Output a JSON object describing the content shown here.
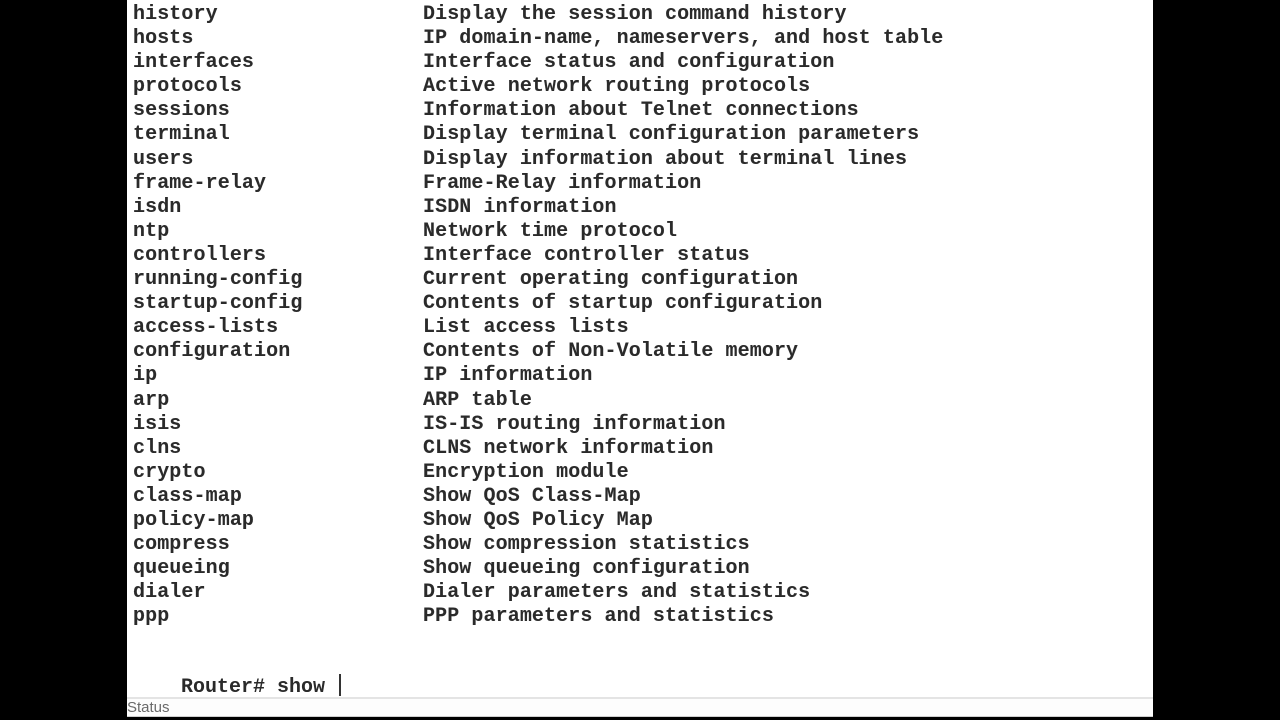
{
  "terminal": {
    "rows": [
      {
        "command": "history",
        "description": "Display the session command history"
      },
      {
        "command": "hosts",
        "description": "IP domain-name, nameservers, and host table"
      },
      {
        "command": "interfaces",
        "description": "Interface status and configuration"
      },
      {
        "command": "protocols",
        "description": "Active network routing protocols"
      },
      {
        "command": "sessions",
        "description": "Information about Telnet connections"
      },
      {
        "command": "terminal",
        "description": "Display terminal configuration parameters"
      },
      {
        "command": "users",
        "description": "Display information about terminal lines"
      },
      {
        "command": "frame-relay",
        "description": "Frame-Relay information"
      },
      {
        "command": "isdn",
        "description": "ISDN information"
      },
      {
        "command": "ntp",
        "description": "Network time protocol"
      },
      {
        "command": "controllers",
        "description": "Interface controller status"
      },
      {
        "command": "running-config",
        "description": "Current operating configuration"
      },
      {
        "command": "startup-config",
        "description": "Contents of startup configuration"
      },
      {
        "command": "access-lists",
        "description": "List access lists"
      },
      {
        "command": "configuration",
        "description": "Contents of Non-Volatile memory"
      },
      {
        "command": "ip",
        "description": "IP information"
      },
      {
        "command": "arp",
        "description": "ARP table"
      },
      {
        "command": "isis",
        "description": "IS-IS routing information"
      },
      {
        "command": "clns",
        "description": "CLNS network information"
      },
      {
        "command": "crypto",
        "description": "Encryption module"
      },
      {
        "command": "class-map",
        "description": "Show QoS Class-Map"
      },
      {
        "command": "policy-map",
        "description": "Show QoS Policy Map"
      },
      {
        "command": "compress",
        "description": "Show compression statistics"
      },
      {
        "command": "queueing",
        "description": "Show queueing configuration"
      },
      {
        "command": "dialer",
        "description": "Dialer parameters and statistics"
      },
      {
        "command": "ppp",
        "description": "PPP parameters and statistics"
      }
    ],
    "prompt": "Router# ",
    "input": "show "
  },
  "statusbar": {
    "label": "Status"
  }
}
